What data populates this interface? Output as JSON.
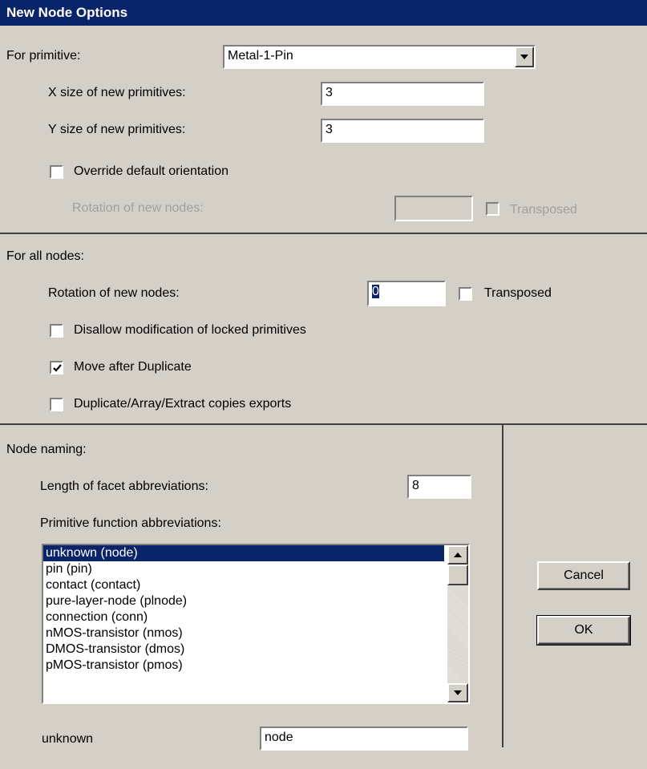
{
  "window": {
    "title": "New Node Options"
  },
  "primitive": {
    "label": "For primitive:",
    "selected": "Metal-1-Pin",
    "x_size_label": "X size of new primitives:",
    "x_size_value": "3",
    "y_size_label": "Y size of new primitives:",
    "y_size_value": "3",
    "override_label": "Override default orientation",
    "override_checked": false,
    "rotation_label": "Rotation of new nodes:",
    "rotation_value": "",
    "transposed_label": "Transposed",
    "transposed_checked": false
  },
  "all_nodes": {
    "label": "For all nodes:",
    "rotation_label": "Rotation of new nodes:",
    "rotation_value": "0",
    "transposed_label": "Transposed",
    "transposed_checked": false,
    "disallow_label": "Disallow modification of locked primitives",
    "disallow_checked": false,
    "move_label": "Move after Duplicate",
    "move_checked": true,
    "dup_label": "Duplicate/Array/Extract copies exports",
    "dup_checked": false
  },
  "naming": {
    "label": "Node naming:",
    "facet_label": "Length of facet abbreviations:",
    "facet_value": "8",
    "func_label": "Primitive function abbreviations:",
    "list_items": [
      "unknown (node)",
      "pin (pin)",
      "contact (contact)",
      "pure-layer-node (plnode)",
      "connection (conn)",
      "nMOS-transistor (nmos)",
      "DMOS-transistor (dmos)",
      "pMOS-transistor (pmos)"
    ],
    "selected_index": 0,
    "edit_label": "unknown",
    "edit_value": "node"
  },
  "buttons": {
    "cancel": "Cancel",
    "ok": "OK"
  }
}
